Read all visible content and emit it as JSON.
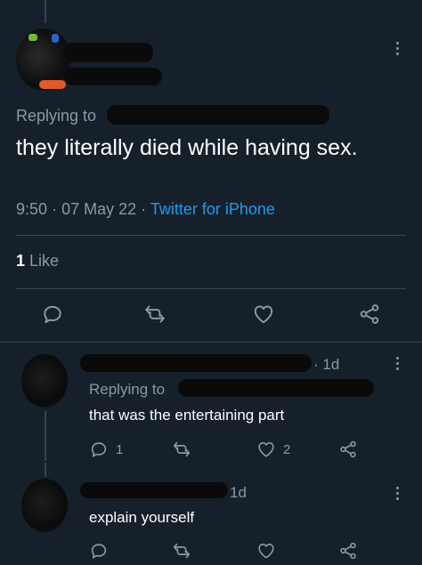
{
  "main_tweet": {
    "replying_label": "Replying to",
    "text": "they literally died while having sex.",
    "time": "9:50",
    "sep1": "·",
    "date": "07 May 22",
    "sep2": "·",
    "source": "Twitter for iPhone",
    "like_count": "1",
    "like_label": "Like"
  },
  "replies": [
    {
      "time": "· 1d",
      "replying_label": "Replying to",
      "text": "that was the entertaining part",
      "reply_count": "1",
      "retweet_count": "",
      "like_count": "2"
    },
    {
      "time": "1d",
      "text": "explain yourself",
      "reply_count": "",
      "retweet_count": "",
      "like_count": ""
    }
  ],
  "colors": {
    "background": "#15202b",
    "text": "#ffffff",
    "muted": "#8b98a5",
    "link": "#1d9bf0",
    "divider": "#38444d"
  },
  "icons": [
    "more-icon",
    "reply-icon",
    "retweet-icon",
    "like-icon",
    "share-icon"
  ]
}
